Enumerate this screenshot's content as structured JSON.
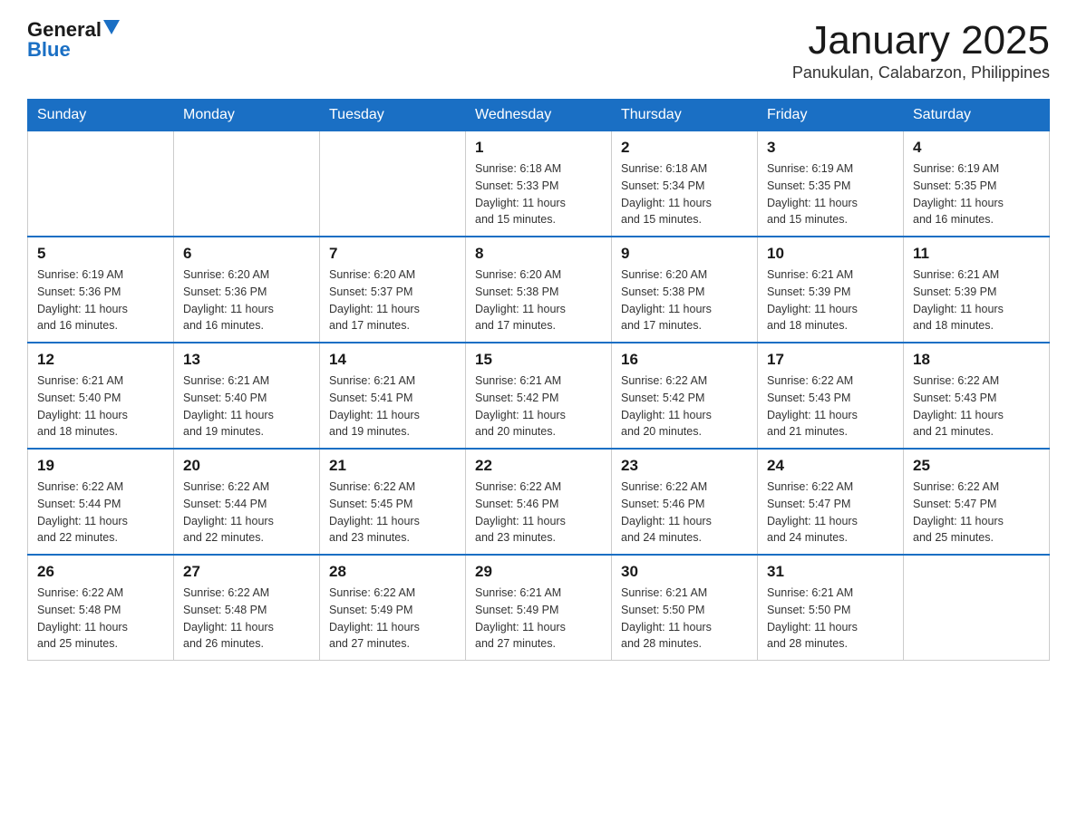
{
  "header": {
    "logo_general": "General",
    "logo_blue": "Blue",
    "title": "January 2025",
    "subtitle": "Panukulan, Calabarzon, Philippines"
  },
  "days_of_week": [
    "Sunday",
    "Monday",
    "Tuesday",
    "Wednesday",
    "Thursday",
    "Friday",
    "Saturday"
  ],
  "weeks": [
    {
      "days": [
        {
          "number": "",
          "info": ""
        },
        {
          "number": "",
          "info": ""
        },
        {
          "number": "",
          "info": ""
        },
        {
          "number": "1",
          "info": "Sunrise: 6:18 AM\nSunset: 5:33 PM\nDaylight: 11 hours\nand 15 minutes."
        },
        {
          "number": "2",
          "info": "Sunrise: 6:18 AM\nSunset: 5:34 PM\nDaylight: 11 hours\nand 15 minutes."
        },
        {
          "number": "3",
          "info": "Sunrise: 6:19 AM\nSunset: 5:35 PM\nDaylight: 11 hours\nand 15 minutes."
        },
        {
          "number": "4",
          "info": "Sunrise: 6:19 AM\nSunset: 5:35 PM\nDaylight: 11 hours\nand 16 minutes."
        }
      ]
    },
    {
      "days": [
        {
          "number": "5",
          "info": "Sunrise: 6:19 AM\nSunset: 5:36 PM\nDaylight: 11 hours\nand 16 minutes."
        },
        {
          "number": "6",
          "info": "Sunrise: 6:20 AM\nSunset: 5:36 PM\nDaylight: 11 hours\nand 16 minutes."
        },
        {
          "number": "7",
          "info": "Sunrise: 6:20 AM\nSunset: 5:37 PM\nDaylight: 11 hours\nand 17 minutes."
        },
        {
          "number": "8",
          "info": "Sunrise: 6:20 AM\nSunset: 5:38 PM\nDaylight: 11 hours\nand 17 minutes."
        },
        {
          "number": "9",
          "info": "Sunrise: 6:20 AM\nSunset: 5:38 PM\nDaylight: 11 hours\nand 17 minutes."
        },
        {
          "number": "10",
          "info": "Sunrise: 6:21 AM\nSunset: 5:39 PM\nDaylight: 11 hours\nand 18 minutes."
        },
        {
          "number": "11",
          "info": "Sunrise: 6:21 AM\nSunset: 5:39 PM\nDaylight: 11 hours\nand 18 minutes."
        }
      ]
    },
    {
      "days": [
        {
          "number": "12",
          "info": "Sunrise: 6:21 AM\nSunset: 5:40 PM\nDaylight: 11 hours\nand 18 minutes."
        },
        {
          "number": "13",
          "info": "Sunrise: 6:21 AM\nSunset: 5:40 PM\nDaylight: 11 hours\nand 19 minutes."
        },
        {
          "number": "14",
          "info": "Sunrise: 6:21 AM\nSunset: 5:41 PM\nDaylight: 11 hours\nand 19 minutes."
        },
        {
          "number": "15",
          "info": "Sunrise: 6:21 AM\nSunset: 5:42 PM\nDaylight: 11 hours\nand 20 minutes."
        },
        {
          "number": "16",
          "info": "Sunrise: 6:22 AM\nSunset: 5:42 PM\nDaylight: 11 hours\nand 20 minutes."
        },
        {
          "number": "17",
          "info": "Sunrise: 6:22 AM\nSunset: 5:43 PM\nDaylight: 11 hours\nand 21 minutes."
        },
        {
          "number": "18",
          "info": "Sunrise: 6:22 AM\nSunset: 5:43 PM\nDaylight: 11 hours\nand 21 minutes."
        }
      ]
    },
    {
      "days": [
        {
          "number": "19",
          "info": "Sunrise: 6:22 AM\nSunset: 5:44 PM\nDaylight: 11 hours\nand 22 minutes."
        },
        {
          "number": "20",
          "info": "Sunrise: 6:22 AM\nSunset: 5:44 PM\nDaylight: 11 hours\nand 22 minutes."
        },
        {
          "number": "21",
          "info": "Sunrise: 6:22 AM\nSunset: 5:45 PM\nDaylight: 11 hours\nand 23 minutes."
        },
        {
          "number": "22",
          "info": "Sunrise: 6:22 AM\nSunset: 5:46 PM\nDaylight: 11 hours\nand 23 minutes."
        },
        {
          "number": "23",
          "info": "Sunrise: 6:22 AM\nSunset: 5:46 PM\nDaylight: 11 hours\nand 24 minutes."
        },
        {
          "number": "24",
          "info": "Sunrise: 6:22 AM\nSunset: 5:47 PM\nDaylight: 11 hours\nand 24 minutes."
        },
        {
          "number": "25",
          "info": "Sunrise: 6:22 AM\nSunset: 5:47 PM\nDaylight: 11 hours\nand 25 minutes."
        }
      ]
    },
    {
      "days": [
        {
          "number": "26",
          "info": "Sunrise: 6:22 AM\nSunset: 5:48 PM\nDaylight: 11 hours\nand 25 minutes."
        },
        {
          "number": "27",
          "info": "Sunrise: 6:22 AM\nSunset: 5:48 PM\nDaylight: 11 hours\nand 26 minutes."
        },
        {
          "number": "28",
          "info": "Sunrise: 6:22 AM\nSunset: 5:49 PM\nDaylight: 11 hours\nand 27 minutes."
        },
        {
          "number": "29",
          "info": "Sunrise: 6:21 AM\nSunset: 5:49 PM\nDaylight: 11 hours\nand 27 minutes."
        },
        {
          "number": "30",
          "info": "Sunrise: 6:21 AM\nSunset: 5:50 PM\nDaylight: 11 hours\nand 28 minutes."
        },
        {
          "number": "31",
          "info": "Sunrise: 6:21 AM\nSunset: 5:50 PM\nDaylight: 11 hours\nand 28 minutes."
        },
        {
          "number": "",
          "info": ""
        }
      ]
    }
  ]
}
